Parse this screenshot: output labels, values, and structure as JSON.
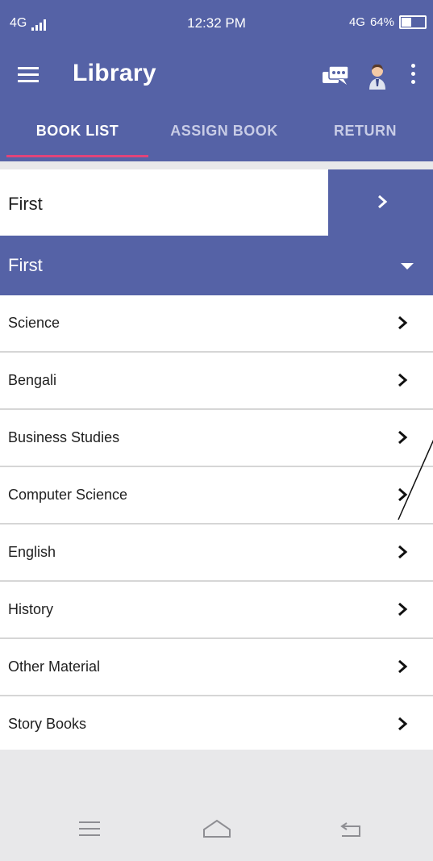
{
  "status_bar": {
    "network": "4G",
    "time": "12:32 PM",
    "network_right": "4G",
    "battery": "64%"
  },
  "app_bar": {
    "title": "Library",
    "icons": [
      "menu-icon",
      "chat-icon",
      "user-avatar-icon",
      "more-vert-icon"
    ]
  },
  "tabs": [
    {
      "label": "BOOK LIST",
      "active": true
    },
    {
      "label": "ASSIGN BOOK",
      "active": false
    },
    {
      "label": "RETURN",
      "active": false
    }
  ],
  "selector": {
    "value": "First",
    "button_icon": "chevron-right-icon"
  },
  "accordion": {
    "label": "First",
    "icon": "caret-down-icon"
  },
  "subjects": [
    "Science",
    "Bengali",
    "Business Studies",
    "Computer Science",
    "English",
    "History",
    "Other Material",
    "Story Books"
  ],
  "nav_bar": {
    "icons": [
      "nav-menu-icon",
      "nav-home-icon",
      "nav-back-icon"
    ]
  },
  "colors": {
    "primary": "#5562a6",
    "tab_indicator": "#e0447a",
    "list_bg": "#ffffff",
    "background": "#e8e8ea"
  }
}
